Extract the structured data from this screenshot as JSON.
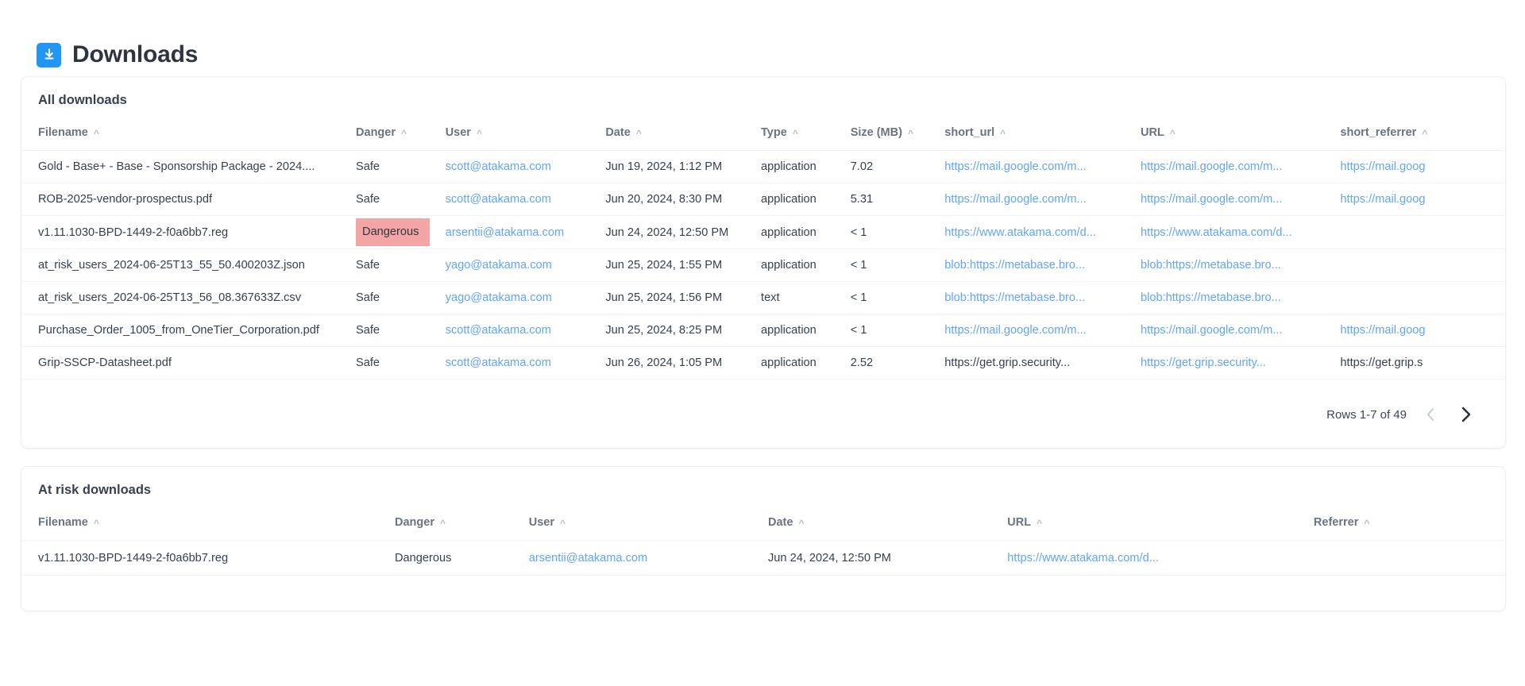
{
  "page": {
    "title": "Downloads",
    "icon": "download-icon",
    "accent_color": "#2196f3",
    "link_color": "#60a5fa",
    "danger_bg": "#f3a4a4"
  },
  "all_downloads": {
    "card_title": "All downloads",
    "columns": [
      {
        "key": "filename",
        "label": "Filename",
        "sort": "^"
      },
      {
        "key": "danger",
        "label": "Danger",
        "sort": "^"
      },
      {
        "key": "user",
        "label": "User",
        "sort": "^"
      },
      {
        "key": "date",
        "label": "Date",
        "sort": "^"
      },
      {
        "key": "type",
        "label": "Type",
        "sort": "^"
      },
      {
        "key": "size",
        "label": "Size (MB)",
        "sort": "^"
      },
      {
        "key": "short_url",
        "label": "short_url",
        "sort": "^"
      },
      {
        "key": "url",
        "label": "URL",
        "sort": "^"
      },
      {
        "key": "short_referrer",
        "label": "short_referrer",
        "sort": "^"
      }
    ],
    "rows": [
      {
        "filename": "Gold - Base+ - Base - Sponsorship Package - 2024....",
        "danger": "Safe",
        "danger_flag": false,
        "user": "scott@atakama.com",
        "date": "Jun 19, 2024, 1:12 PM",
        "type": "application",
        "size": "7.02",
        "short_url": "https://mail.google.com/m...",
        "short_url_link": true,
        "url": "https://mail.google.com/m...",
        "url_link": true,
        "short_referrer": "https://mail.goog",
        "short_referrer_link": true
      },
      {
        "filename": "ROB-2025-vendor-prospectus.pdf",
        "danger": "Safe",
        "danger_flag": false,
        "user": "scott@atakama.com",
        "date": "Jun 20, 2024, 8:30 PM",
        "type": "application",
        "size": "5.31",
        "short_url": "https://mail.google.com/m...",
        "short_url_link": true,
        "url": "https://mail.google.com/m...",
        "url_link": true,
        "short_referrer": "https://mail.goog",
        "short_referrer_link": true
      },
      {
        "filename": "v1.11.1030-BPD-1449-2-f0a6bb7.reg",
        "danger": "Dangerous",
        "danger_flag": true,
        "user": "arsentii@atakama.com",
        "date": "Jun 24, 2024, 12:50 PM",
        "type": "application",
        "size": "< 1",
        "short_url": "https://www.atakama.com/d...",
        "short_url_link": true,
        "url": "https://www.atakama.com/d...",
        "url_link": true,
        "short_referrer": "",
        "short_referrer_link": false
      },
      {
        "filename": "at_risk_users_2024-06-25T13_55_50.400203Z.json",
        "danger": "Safe",
        "danger_flag": false,
        "user": "yago@atakama.com",
        "date": "Jun 25, 2024, 1:55 PM",
        "type": "application",
        "size": "< 1",
        "short_url": "blob:https://metabase.bro...",
        "short_url_link": true,
        "url": "blob:https://metabase.bro...",
        "url_link": true,
        "short_referrer": "",
        "short_referrer_link": false
      },
      {
        "filename": "at_risk_users_2024-06-25T13_56_08.367633Z.csv",
        "danger": "Safe",
        "danger_flag": false,
        "user": "yago@atakama.com",
        "date": "Jun 25, 2024, 1:56 PM",
        "type": "text",
        "size": "< 1",
        "short_url": "blob:https://metabase.bro...",
        "short_url_link": true,
        "url": "blob:https://metabase.bro...",
        "url_link": true,
        "short_referrer": "",
        "short_referrer_link": false
      },
      {
        "filename": "Purchase_Order_1005_from_OneTier_Corporation.pdf",
        "danger": "Safe",
        "danger_flag": false,
        "user": "scott@atakama.com",
        "date": "Jun 25, 2024, 8:25 PM",
        "type": "application",
        "size": "< 1",
        "short_url": "https://mail.google.com/m...",
        "short_url_link": true,
        "url": "https://mail.google.com/m...",
        "url_link": true,
        "short_referrer": "https://mail.goog",
        "short_referrer_link": true
      },
      {
        "filename": "Grip-SSCP-Datasheet.pdf",
        "danger": "Safe",
        "danger_flag": false,
        "user": "scott@atakama.com",
        "date": "Jun 26, 2024, 1:05 PM",
        "type": "application",
        "size": "2.52",
        "short_url": "https://get.grip.security...",
        "short_url_link": false,
        "url": "https://get.grip.security...",
        "url_link": true,
        "short_referrer": "https://get.grip.s",
        "short_referrer_link": false
      }
    ],
    "pagination": {
      "rows_label": "Rows 1-7 of 49",
      "prev_label": "previous-page",
      "next_label": "next-page"
    }
  },
  "at_risk_downloads": {
    "card_title": "At risk downloads",
    "columns": [
      {
        "key": "filename",
        "label": "Filename",
        "sort": "^"
      },
      {
        "key": "danger",
        "label": "Danger",
        "sort": "^"
      },
      {
        "key": "user",
        "label": "User",
        "sort": "^"
      },
      {
        "key": "date",
        "label": "Date",
        "sort": "^"
      },
      {
        "key": "url",
        "label": "URL",
        "sort": "^"
      },
      {
        "key": "referrer",
        "label": "Referrer",
        "sort": "^"
      }
    ],
    "rows": [
      {
        "filename": "v1.11.1030-BPD-1449-2-f0a6bb7.reg",
        "danger": "Dangerous",
        "user": "arsentii@atakama.com",
        "date": "Jun 24, 2024, 12:50 PM",
        "url": "https://www.atakama.com/d...",
        "url_link": true,
        "referrer": ""
      }
    ]
  }
}
